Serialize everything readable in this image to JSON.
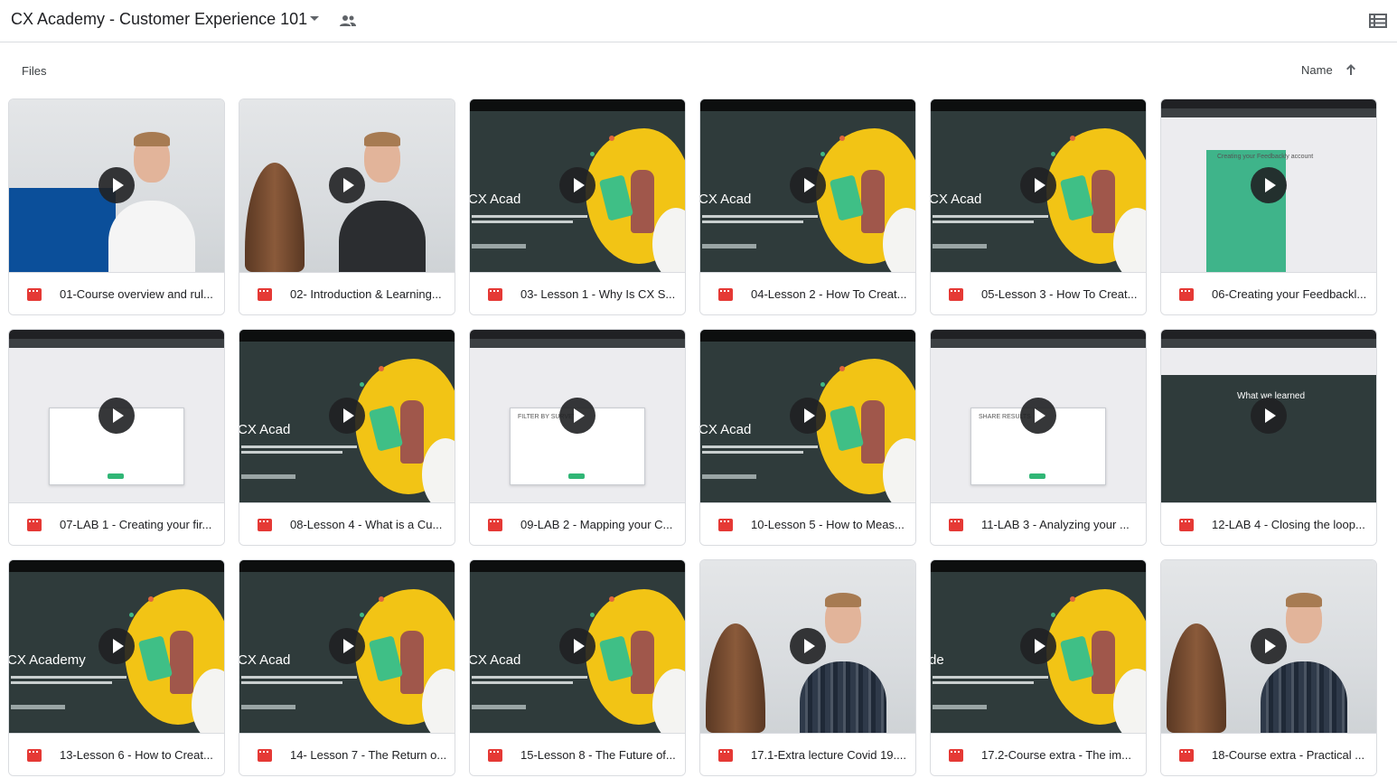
{
  "header": {
    "folder_title": "CX Academy - Customer Experience 101"
  },
  "section": {
    "files_label": "Files",
    "sort_label": "Name"
  },
  "colors": {
    "video_icon": "#e53935",
    "slide_bg": "#2f3b3b",
    "slide_accent": "#f2c415",
    "border": "#dadce0"
  },
  "files": [
    {
      "name": "01-Course overview and rul...",
      "thumb": "person-board"
    },
    {
      "name": "02- Introduction & Learning...",
      "thumb": "person-surf-dark"
    },
    {
      "name": "03- Lesson 1 - Why Is CX S...",
      "thumb": "slide",
      "slide_title": "CX Acad"
    },
    {
      "name": "04-Lesson 2 - How To Creat...",
      "thumb": "slide",
      "slide_title": "CX Acad"
    },
    {
      "name": "05-Lesson 3 - How To Creat...",
      "thumb": "slide",
      "slide_title": "CX Acad"
    },
    {
      "name": "06-Creating your Feedbackl...",
      "thumb": "screen-green",
      "screen_title": "Creating your Feedbackly account"
    },
    {
      "name": "07-LAB 1 - Creating your fir...",
      "thumb": "screen-modal"
    },
    {
      "name": "08-Lesson 4 - What is a Cu...",
      "thumb": "slide",
      "slide_title": "CX Acad"
    },
    {
      "name": "09-LAB 2 - Mapping your C...",
      "thumb": "screen-modal",
      "screen_title": "FILTER BY SURVEY"
    },
    {
      "name": "10-Lesson 5 - How to Meas...",
      "thumb": "slide",
      "slide_title": "CX Acad"
    },
    {
      "name": "11-LAB 3 - Analyzing your ...",
      "thumb": "screen-modal",
      "screen_title": "SHARE RESULTS"
    },
    {
      "name": "12-LAB 4 - Closing the loop...",
      "thumb": "screen-dark",
      "screen_title": "What we learned"
    },
    {
      "name": "13-Lesson 6 - How to Creat...",
      "thumb": "slide",
      "slide_title": "CX Academy"
    },
    {
      "name": "14- Lesson 7 - The Return o...",
      "thumb": "slide",
      "slide_title": "CX Acad"
    },
    {
      "name": "15-Lesson 8 - The Future of...",
      "thumb": "slide",
      "slide_title": "CX Acad"
    },
    {
      "name": "17.1-Extra lecture Covid 19....",
      "thumb": "person-surf-plaid"
    },
    {
      "name": "17.2-Course extra - The im...",
      "thumb": "slide",
      "slide_title": "de"
    },
    {
      "name": "18-Course extra - Practical ...",
      "thumb": "person-surf-plaid"
    }
  ]
}
